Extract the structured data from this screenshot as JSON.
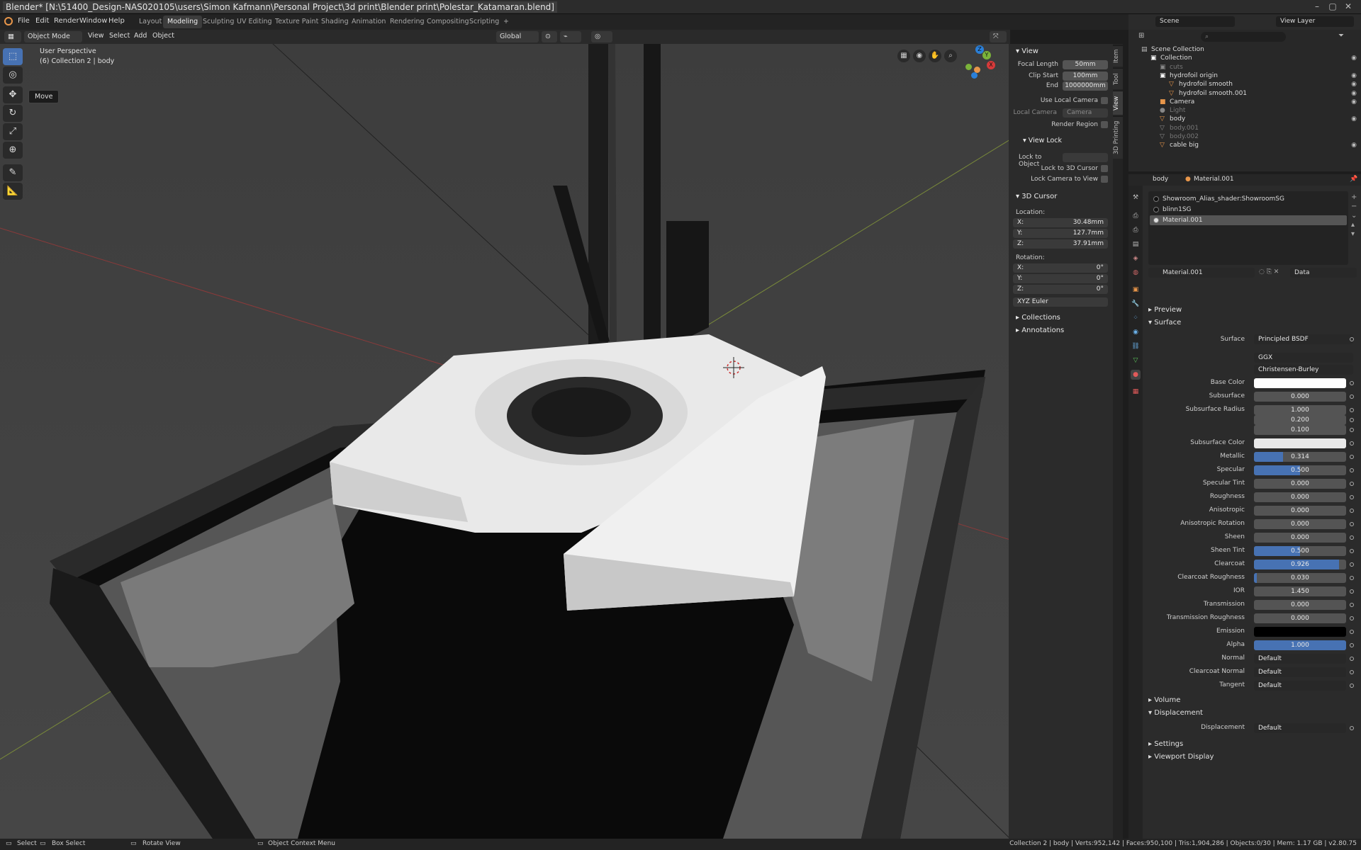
{
  "window": {
    "title": "Blender* [N:\\51400_Design-NAS020105\\users\\Simon Kafmann\\Personal Project\\3d print\\Blender print\\Polestar_Katamaran.blend]",
    "min": "–",
    "max": "▢",
    "close": "✕"
  },
  "menu": [
    "File",
    "Edit",
    "Render",
    "Window",
    "Help"
  ],
  "workspaces": [
    "Layout",
    "Modeling",
    "Sculpting",
    "UV Editing",
    "Texture Paint",
    "Shading",
    "Animation",
    "Rendering",
    "Compositing",
    "Scripting"
  ],
  "active_workspace": "Modeling",
  "add_tab": "+",
  "scene": {
    "name": "Scene",
    "view_layer": "View Layer"
  },
  "viewport_header": {
    "mode": "Object Mode",
    "menus": [
      "View",
      "Select",
      "Add",
      "Object"
    ],
    "orientation": "Global"
  },
  "viewport": {
    "perspective": "User Perspective",
    "collection_line": "(6) Collection 2 | body",
    "tooltip": "Move",
    "gizmo_axes": [
      "Z",
      "Y",
      "X"
    ]
  },
  "npanel": {
    "tabs": [
      "Item",
      "Tool",
      "View",
      "3D Printing"
    ],
    "view": {
      "header": "View",
      "focal_length_label": "Focal Length",
      "focal_length": "50mm",
      "clip_start_label": "Clip Start",
      "clip_start": "100mm",
      "end_label": "End",
      "end": "1000000mm",
      "use_local_camera": "Use Local Camera",
      "local_camera_label": "Local Camera",
      "local_camera": "Camera",
      "render_region": "Render Region"
    },
    "view_lock": {
      "header": "View Lock",
      "lock_to_object": "Lock to Object",
      "lock_to_3d_cursor": "Lock to 3D Cursor",
      "lock_camera_to_view": "Lock Camera to View"
    },
    "cursor": {
      "header": "3D Cursor",
      "location_label": "Location:",
      "location": [
        {
          "axis": "X:",
          "value": "30.48mm"
        },
        {
          "axis": "Y:",
          "value": "127.7mm"
        },
        {
          "axis": "Z:",
          "value": "37.91mm"
        }
      ],
      "rotation_label": "Rotation:",
      "rotation": [
        {
          "axis": "X:",
          "value": "0°"
        },
        {
          "axis": "Y:",
          "value": "0°"
        },
        {
          "axis": "Z:",
          "value": "0°"
        }
      ],
      "rotation_mode": "XYZ Euler"
    },
    "collections": "Collections",
    "annotations": "Annotations"
  },
  "outliner": {
    "rows": [
      {
        "label": "Scene Collection",
        "indent": 0,
        "icon": "▤",
        "color": "#bbbbbb",
        "eye": false,
        "dim": false
      },
      {
        "label": "Collection",
        "indent": 1,
        "icon": "▣",
        "color": "#ffffff",
        "eye": true,
        "dim": false
      },
      {
        "label": "cuts",
        "indent": 2,
        "icon": "▣",
        "color": "#888888",
        "eye": false,
        "dim": true
      },
      {
        "label": "hydrofoil origin",
        "indent": 2,
        "icon": "▣",
        "color": "#ffffff",
        "eye": true,
        "dim": false
      },
      {
        "label": "hydrofoil smooth",
        "indent": 3,
        "icon": "▽",
        "color": "#e8964a",
        "eye": true,
        "dim": false
      },
      {
        "label": "hydrofoil smooth.001",
        "indent": 3,
        "icon": "▽",
        "color": "#e8964a",
        "eye": true,
        "dim": false
      },
      {
        "label": "Camera",
        "indent": 2,
        "icon": "■",
        "color": "#e8964a",
        "eye": true,
        "dim": false
      },
      {
        "label": "Light",
        "indent": 2,
        "icon": "●",
        "color": "#888888",
        "eye": false,
        "dim": true
      },
      {
        "label": "body",
        "indent": 2,
        "icon": "▽",
        "color": "#e8964a",
        "eye": true,
        "dim": false
      },
      {
        "label": "body.001",
        "indent": 2,
        "icon": "▽",
        "color": "#888888",
        "eye": false,
        "dim": true
      },
      {
        "label": "body.002",
        "indent": 2,
        "icon": "▽",
        "color": "#888888",
        "eye": false,
        "dim": true
      },
      {
        "label": "cable big",
        "indent": 2,
        "icon": "▽",
        "color": "#e8964a",
        "eye": true,
        "dim": false
      }
    ]
  },
  "properties": {
    "breadcrumb_object": "body",
    "breadcrumb_material": "Material.001",
    "slots": [
      "Showroom_Alias_shader:ShowroomSG",
      "blinn1SG",
      "Material.001"
    ],
    "active_slot": 2,
    "material_name": "Material.001",
    "link": "Data",
    "sections": {
      "preview": "Preview",
      "surface": "Surface",
      "volume": "Volume",
      "displacement": "Displacement",
      "settings": "Settings",
      "viewport_display": "Viewport Display"
    },
    "surface_label": "Surface",
    "surface_shader": "Principled BSDF",
    "distribution": "GGX",
    "subsurface_method": "Christensen-Burley",
    "fields": [
      {
        "label": "Base Color",
        "type": "color",
        "color": "#ffffff"
      },
      {
        "label": "Subsurface",
        "type": "num",
        "value": "0.000",
        "fill": 0
      },
      {
        "label": "Subsurface Radius",
        "type": "num",
        "value": "1.000",
        "fill": 0
      },
      {
        "label": "",
        "type": "num",
        "value": "0.200",
        "fill": 0
      },
      {
        "label": "",
        "type": "num",
        "value": "0.100",
        "fill": 0
      },
      {
        "label": "Subsurface Color",
        "type": "color",
        "color": "#e8e8e8"
      },
      {
        "label": "Metallic",
        "type": "num",
        "value": "0.314",
        "fill": 0.314
      },
      {
        "label": "Specular",
        "type": "num",
        "value": "0.500",
        "fill": 0.5
      },
      {
        "label": "Specular Tint",
        "type": "num",
        "value": "0.000",
        "fill": 0
      },
      {
        "label": "Roughness",
        "type": "num",
        "value": "0.000",
        "fill": 0
      },
      {
        "label": "Anisotropic",
        "type": "num",
        "value": "0.000",
        "fill": 0
      },
      {
        "label": "Anisotropic Rotation",
        "type": "num",
        "value": "0.000",
        "fill": 0
      },
      {
        "label": "Sheen",
        "type": "num",
        "value": "0.000",
        "fill": 0
      },
      {
        "label": "Sheen Tint",
        "type": "num",
        "value": "0.500",
        "fill": 0.5
      },
      {
        "label": "Clearcoat",
        "type": "num",
        "value": "0.926",
        "fill": 0.926
      },
      {
        "label": "Clearcoat Roughness",
        "type": "num",
        "value": "0.030",
        "fill": 0.03
      },
      {
        "label": "IOR",
        "type": "num",
        "value": "1.450",
        "fill": 0
      },
      {
        "label": "Transmission",
        "type": "num",
        "value": "0.000",
        "fill": 0
      },
      {
        "label": "Transmission Roughness",
        "type": "num",
        "value": "0.000",
        "fill": 0
      },
      {
        "label": "Emission",
        "type": "color",
        "color": "#000000"
      },
      {
        "label": "Alpha",
        "type": "num",
        "value": "1.000",
        "fill": 1
      },
      {
        "label": "Normal",
        "type": "dd",
        "value": "Default"
      },
      {
        "label": "Clearcoat Normal",
        "type": "dd",
        "value": "Default"
      },
      {
        "label": "Tangent",
        "type": "dd",
        "value": "Default"
      }
    ],
    "displacement_label": "Displacement",
    "displacement_value": "Default"
  },
  "status": {
    "select": "Select",
    "box_select": "Box Select",
    "rotate_view": "Rotate View",
    "context_menu": "Object Context Menu",
    "stats": "Collection 2 | body | Verts:952,142 | Faces:950,100 | Tris:1,904,286 | Objects:0/30 | Mem: 1.17 GB | v2.80.75"
  },
  "colors": {
    "accent": "#4772b3",
    "active_tab": "#3c3c3c",
    "object_orange": "#e8964a"
  }
}
